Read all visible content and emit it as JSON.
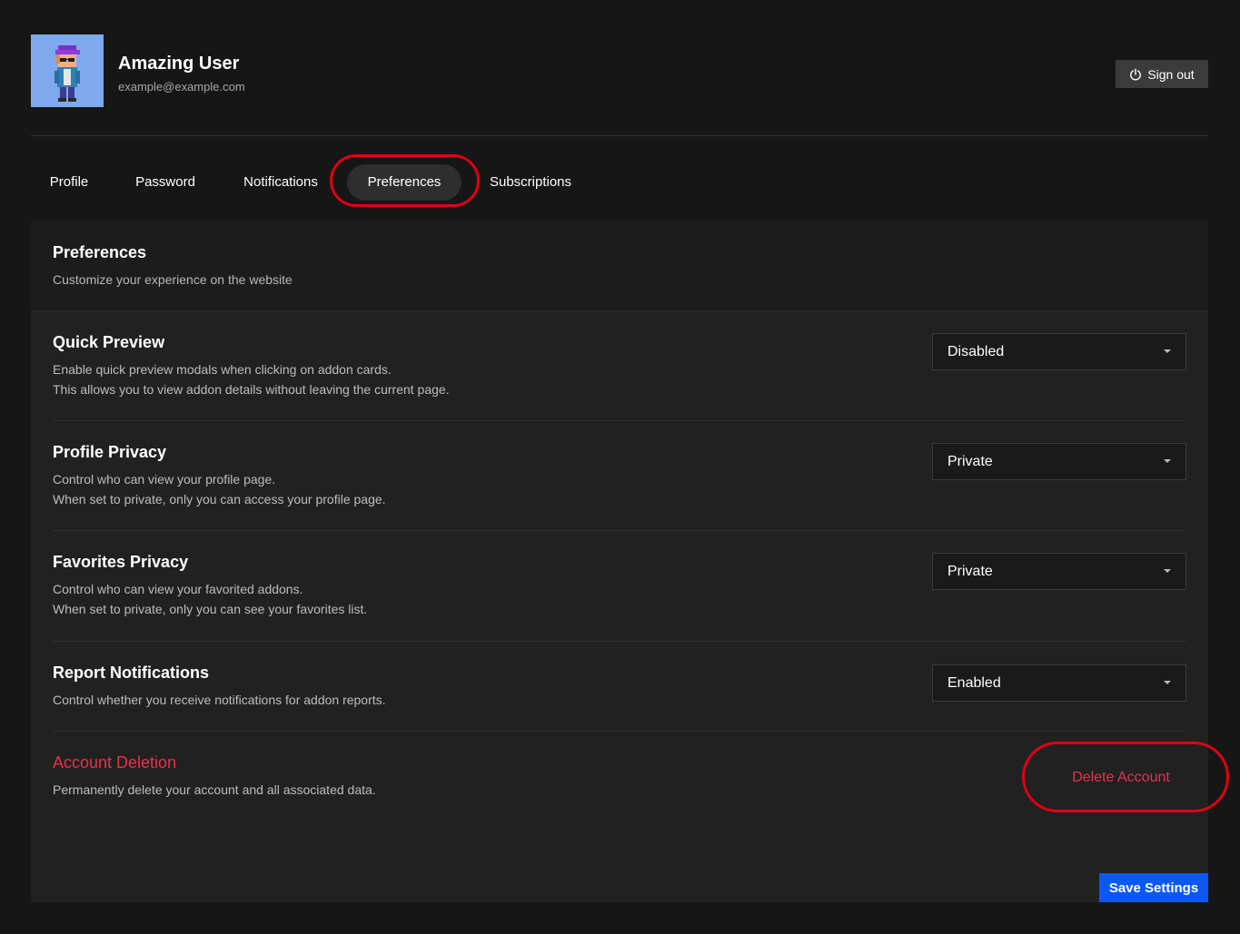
{
  "user": {
    "name": "Amazing User",
    "email": "example@example.com",
    "avatar_icon": "pixel-character-avatar"
  },
  "header": {
    "signout_label": "Sign out",
    "signout_icon": "power-icon"
  },
  "tabs": [
    {
      "label": "Profile"
    },
    {
      "label": "Password"
    },
    {
      "label": "Notifications"
    },
    {
      "label": "Preferences",
      "active": true
    },
    {
      "label": "Subscriptions"
    }
  ],
  "panel": {
    "title": "Preferences",
    "subtitle": "Customize your experience on the website"
  },
  "settings": [
    {
      "title": "Quick Preview",
      "desc": [
        "Enable quick preview modals when clicking on addon cards.",
        "This allows you to view addon details without leaving the current page."
      ],
      "value": "Disabled"
    },
    {
      "title": "Profile Privacy",
      "desc": [
        "Control who can view your profile page.",
        "When set to private, only you can access your profile page."
      ],
      "value": "Private"
    },
    {
      "title": "Favorites Privacy",
      "desc": [
        "Control who can view your favorited addons.",
        "When set to private, only you can see your favorites list."
      ],
      "value": "Private"
    },
    {
      "title": "Report Notifications",
      "desc": [
        "Control whether you receive notifications for addon reports."
      ],
      "value": "Enabled"
    }
  ],
  "danger": {
    "title": "Account Deletion",
    "desc": "Permanently delete your account and all associated data.",
    "button": "Delete Account"
  },
  "save_label": "Save Settings",
  "colors": {
    "background": "#161616",
    "panel": "#212121",
    "accent": "#0b58f5",
    "danger": "#e8334a",
    "highlight": "#e00012"
  }
}
